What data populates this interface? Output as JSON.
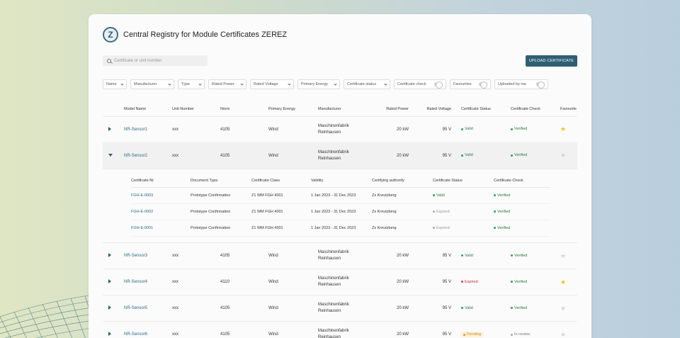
{
  "app": {
    "logo_letter": "Z",
    "title": "Central Registry for Module Certificates ZEREZ",
    "search_placeholder": "Certificate or unit number",
    "upload_label": "UPLOAD CERTIFICATE"
  },
  "filters": [
    {
      "label": "Name",
      "kind": "select"
    },
    {
      "label": "Manufacturer",
      "kind": "select"
    },
    {
      "label": "Type",
      "kind": "select"
    },
    {
      "label": "Rated Power",
      "kind": "select"
    },
    {
      "label": "Rated Voltage",
      "kind": "select"
    },
    {
      "label": "Primary Energy",
      "kind": "select"
    },
    {
      "label": "Certificate status",
      "kind": "select"
    },
    {
      "label": "Certificate check",
      "kind": "toggle"
    },
    {
      "label": "Favourites",
      "kind": "toggle"
    },
    {
      "label": "Uploaded by me",
      "kind": "toggle"
    }
  ],
  "table": {
    "headers": [
      "",
      "Model Name",
      "Unit Number",
      "Norm",
      "Primary Energy",
      "Manufacturer",
      "Rated Power",
      "Rated Voltage",
      "Certificate Status",
      "Certificate Check",
      "Favourite"
    ],
    "rows": [
      {
        "model": "NR-Sensor1",
        "unit": "xxx",
        "norm": "4105",
        "energy": "Wind",
        "manufacturer": "Maschinenfabrik Reinhausen",
        "power": "20 kW",
        "voltage": "95 V",
        "status": "Valid",
        "status_class": "st-valid",
        "check": "Verified",
        "check_class": "st-verified",
        "fav": true,
        "expanded": false
      },
      {
        "model": "NR-Sensor2",
        "unit": "xxx",
        "norm": "4105",
        "energy": "Wind",
        "manufacturer": "Maschinenfabrik Reinhausen",
        "power": "20 kW",
        "voltage": "95 V",
        "status": "Valid",
        "status_class": "st-valid",
        "check": "Verified",
        "check_class": "st-verified",
        "fav": false,
        "expanded": true
      },
      {
        "model": "NR-Sensor3",
        "unit": "xxx",
        "norm": "4105",
        "energy": "Wind",
        "manufacturer": "Maschinenfabrik Reinhausen",
        "power": "20 kW",
        "voltage": "95 V",
        "status": "Valid",
        "status_class": "st-valid",
        "check": "Verified",
        "check_class": "st-verified",
        "fav": false,
        "expanded": false
      },
      {
        "model": "NR-Sensor4",
        "unit": "xxx",
        "norm": "4110",
        "energy": "Wind",
        "manufacturer": "Maschinenfabrik Reinhausen",
        "power": "20 kW",
        "voltage": "95 V",
        "status": "Expired",
        "status_class": "st-expired",
        "check": "Verified",
        "check_class": "st-verified",
        "fav": true,
        "expanded": false
      },
      {
        "model": "NR-Sensor5",
        "unit": "xxx",
        "norm": "4105",
        "energy": "Wind",
        "manufacturer": "Maschinenfabrik Reinhausen",
        "power": "20 kW",
        "voltage": "95 V",
        "status": "Valid",
        "status_class": "st-valid",
        "check": "Verified",
        "check_class": "st-verified",
        "fav": false,
        "expanded": false
      },
      {
        "model": "NR-Sensor6",
        "unit": "xxx",
        "norm": "4105",
        "energy": "Wind",
        "manufacturer": "Maschinenfabrik Reinhausen",
        "power": "20 kW",
        "voltage": "95 V",
        "status": "Pending",
        "status_class": "st-pending",
        "check": "In review",
        "check_class": "st-review",
        "fav": false,
        "expanded": false
      }
    ]
  },
  "nested": {
    "headers": [
      "Certificate Nr",
      "Document Type",
      "Certificate Class",
      "Validity",
      "Certifying authority",
      "Certificate Status",
      "Certificate Check"
    ],
    "rows": [
      {
        "nr": "FGH-E-0003",
        "doc": "Prototype Confirmation",
        "class": "Z1 WM FGH 4001",
        "validity": "1 Jan 2023 - 31 Dec 2023",
        "authority": "Zs Kreutzberg",
        "status": "Valid",
        "status_class": "st-valid",
        "check": "Verified",
        "check_class": "st-verified"
      },
      {
        "nr": "FGH-E-0002",
        "doc": "Prototype Confirmation",
        "class": "Z1 WM FGH 4001",
        "validity": "1 Jan 2023 - 31 Dec 2023",
        "authority": "Zs Kreutzberg",
        "status": "Expired",
        "status_class": "st-expired-grey",
        "check": "Verified",
        "check_class": "st-verified"
      },
      {
        "nr": "FGH-E-0001",
        "doc": "Prototype Confirmation",
        "class": "Z1 WM FGH 4001",
        "validity": "1 Jan 2023 - 31 Dec 2023",
        "authority": "Zs Kreutzberg",
        "status": "Expired",
        "status_class": "st-expired-grey",
        "check": "Verified",
        "check_class": "st-verified"
      }
    ]
  },
  "colors": {
    "accent": "#2f5f74",
    "valid": "#2aa24a",
    "expired": "#d43f3f",
    "pending": "#e09a20",
    "favourite": "#f2c511"
  }
}
